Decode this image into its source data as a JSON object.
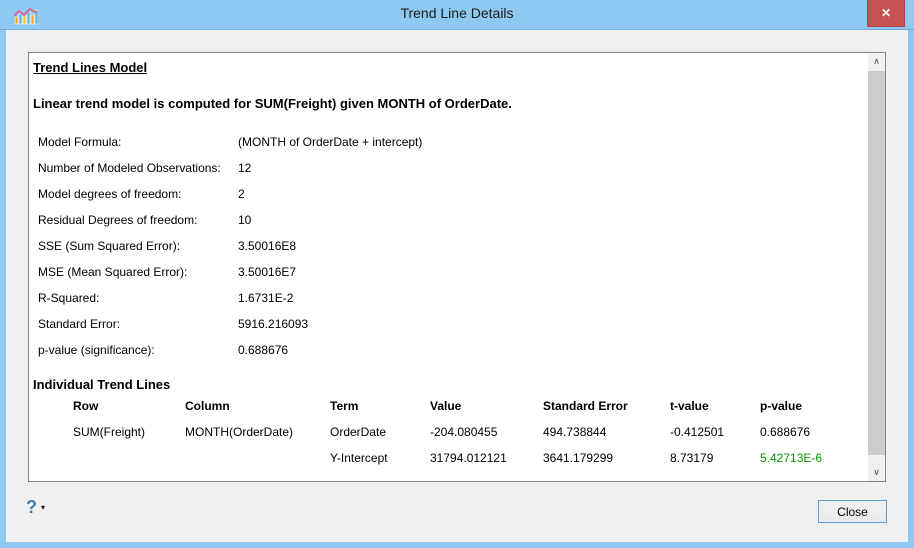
{
  "window": {
    "title": "Trend Line Details",
    "close_glyph": "✕"
  },
  "report": {
    "heading": "Trend Lines Model",
    "description": "Linear trend model is computed for SUM(Freight) given MONTH of OrderDate.",
    "stats": [
      {
        "label": "Model Formula:",
        "value": "(MONTH of OrderDate + intercept)"
      },
      {
        "label": "Number of Modeled Observations:",
        "value": "12"
      },
      {
        "label": "Model degrees of freedom:",
        "value": "2"
      },
      {
        "label": "Residual Degrees of freedom:",
        "value": "10"
      },
      {
        "label": "SSE (Sum Squared Error):",
        "value": "3.50016E8"
      },
      {
        "label": "MSE (Mean Squared Error):",
        "value": "3.50016E7"
      },
      {
        "label": "R-Squared:",
        "value": "1.6731E-2"
      },
      {
        "label": "Standard Error:",
        "value": "5916.216093"
      },
      {
        "label": "p-value (significance):",
        "value": "0.688676"
      }
    ],
    "trend_table": {
      "heading": "Individual Trend Lines",
      "columns": [
        "Row",
        "Column",
        "Term",
        "Value",
        "Standard Error",
        "t-value",
        "p-value"
      ],
      "rows": [
        {
          "row": "SUM(Freight)",
          "column": "MONTH(OrderDate)",
          "term": "OrderDate",
          "value": "-204.080455",
          "std_error": "494.738844",
          "t_value": "-0.412501",
          "p_value": "0.688676",
          "p_significant": false
        },
        {
          "row": "",
          "column": "",
          "term": "Y-Intercept",
          "value": "31794.012121",
          "std_error": "3641.179299",
          "t_value": "8.73179",
          "p_value": "5.42713E-6",
          "p_significant": true
        }
      ]
    }
  },
  "scrollbar": {
    "up_glyph": "∧",
    "down_glyph": "∨"
  },
  "footer": {
    "help_glyph": "?",
    "help_caret": "▾",
    "close_label": "Close"
  },
  "colors": {
    "titlebar": "#8ec9f2",
    "frame": "#8ec9f2",
    "close": "#c75050",
    "significant_p": "#009900",
    "help": "#3e7fb1",
    "button_border": "#5e9ed6"
  }
}
